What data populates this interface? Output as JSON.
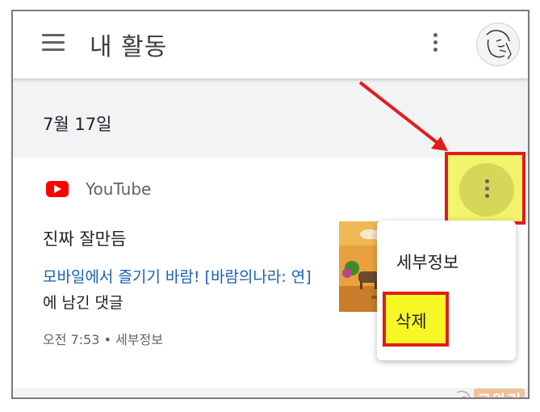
{
  "app_bar": {
    "title": "내 활동",
    "menu_icon": "hamburger-menu-icon",
    "more_icon": "more-vert-icon",
    "avatar_icon": "user-avatar-sketch"
  },
  "date_heading": "7월 17일",
  "activity": {
    "service_icon": "youtube-logo-icon",
    "service_name": "YouTube",
    "title": "진짜 잘만듬",
    "link_text": "모바일에서 즐기기 바람! [바람의나라: 연]",
    "suffix_text": " 에 남긴 댓글",
    "time": "오전 7:53",
    "separator": "•",
    "details_link": "세부정보",
    "thumbnail": "video-thumbnail-game-scene",
    "more_icon": "more-vert-icon"
  },
  "popup_menu": {
    "items": [
      {
        "label": "세부정보"
      },
      {
        "label": "삭제"
      }
    ]
  },
  "watermark": {
    "text": "코와리"
  },
  "colors": {
    "highlight_border": "#e11c1c",
    "highlight_fill": "#f7f725",
    "link": "#1a5fb4",
    "youtube_red": "#ff0000",
    "app_background": "#f1f3f4"
  }
}
